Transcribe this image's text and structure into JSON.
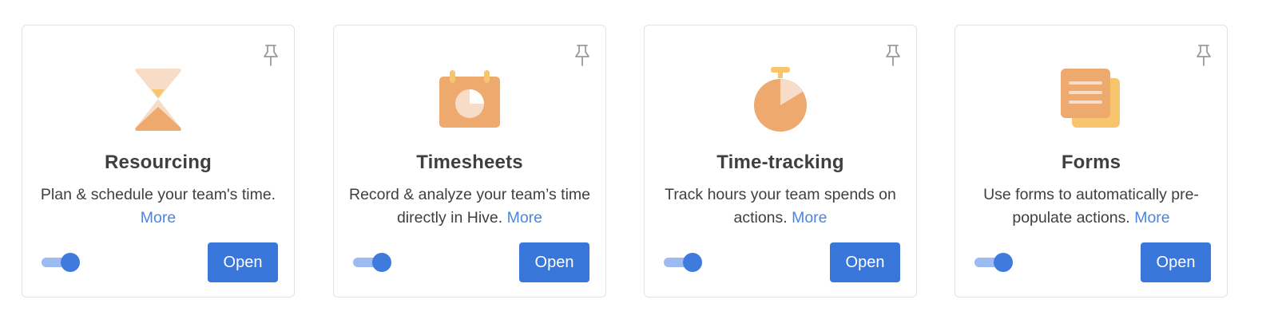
{
  "colors": {
    "accent": "#3877d9",
    "link": "#4a86e0",
    "icon_orange": "#eea96e",
    "icon_peach": "#f7dcc8",
    "icon_yellow": "#f7c56e",
    "toggle_track": "#9dbaf1",
    "toggle_knob": "#3f7bdc"
  },
  "cards": [
    {
      "icon": "hourglass-icon",
      "title": "Resourcing",
      "description": "Plan & schedule your team's time.",
      "more_label": "More",
      "enabled": true,
      "open_label": "Open"
    },
    {
      "icon": "calendar-pie-icon",
      "title": "Timesheets",
      "description": "Record & analyze your team’s time directly in Hive.",
      "more_label": "More",
      "enabled": true,
      "open_label": "Open"
    },
    {
      "icon": "stopwatch-icon",
      "title": "Time-tracking",
      "description": "Track hours your team spends on actions.",
      "more_label": "More",
      "enabled": true,
      "open_label": "Open"
    },
    {
      "icon": "forms-icon",
      "title": "Forms",
      "description": "Use forms to automatically pre-populate actions.",
      "more_label": "More",
      "enabled": true,
      "open_label": "Open"
    }
  ]
}
